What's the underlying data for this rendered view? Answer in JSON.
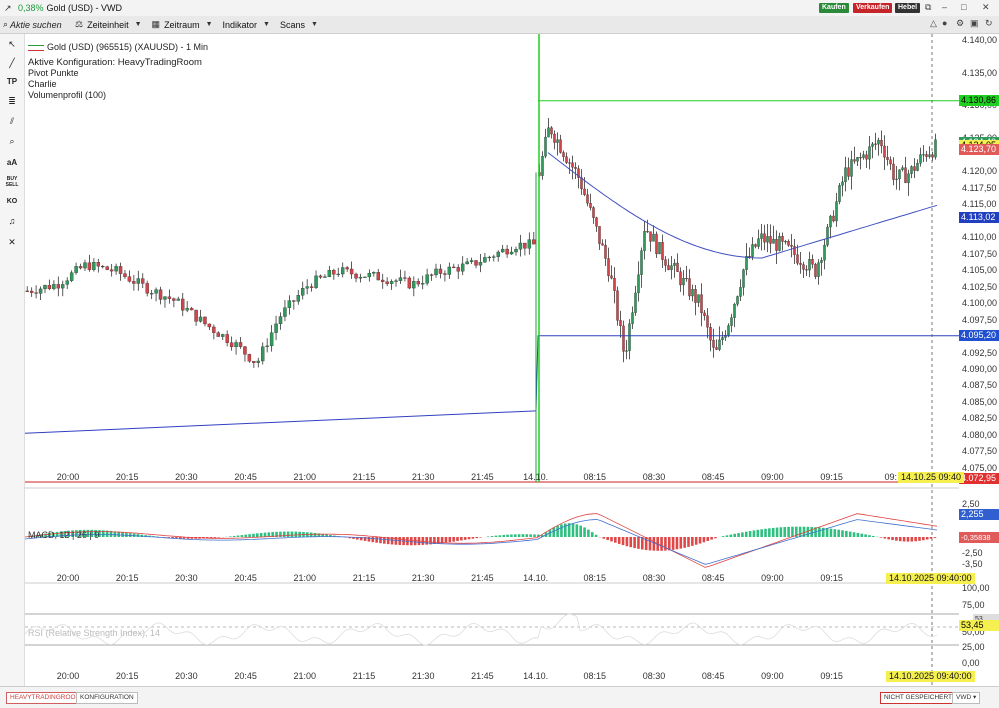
{
  "window": {
    "change_pct": "0,38%",
    "title": "Gold (USD) - VWD",
    "buttons": {
      "buy": "Kaufen",
      "sell": "Verkaufen",
      "leverage": "Hebel"
    },
    "colors": {
      "buy": "#2a8a3a",
      "sell": "#c4242a",
      "leverage": "#333333"
    }
  },
  "toolbar": {
    "search_placeholder": "Aktie suchen",
    "items": [
      {
        "label": "Zeiteinheit",
        "icon": "scale-icon"
      },
      {
        "label": "Zeitraum",
        "icon": "calendar-icon"
      },
      {
        "label": "Indikator",
        "icon": "none"
      },
      {
        "label": "Scans",
        "icon": "none"
      }
    ]
  },
  "left_tools": [
    "cursor-icon",
    "line-icon",
    "TP",
    "fib-icon",
    "parallel-icon",
    "zoom-icon",
    "aA",
    "BUY SELL",
    "KO",
    "sound-icon",
    "close-icon"
  ],
  "legend": {
    "instrument": "Gold (USD) (965515) (XAUUSD) - 1 Min",
    "config": "Aktive Konfiguration: HeavyTradingRoom",
    "pivot": "Pivot Punkte",
    "charlie": "Charlie",
    "volume": "Volumenprofil (100)"
  },
  "price_axis": {
    "labels": [
      "4.140,00",
      "4.135,00",
      "4.130,00",
      "4.125,00",
      "4.120,00",
      "4.117,50",
      "4.115,00",
      "4.110,00",
      "4.107,50",
      "4.105,00",
      "4.102,50",
      "4.100,00",
      "4.097,50",
      "4.092,50",
      "4.090,00",
      "4.087,50",
      "4.085,00",
      "4.082,50",
      "4.080,00",
      "4.077,50",
      "4.075,00"
    ],
    "tags": [
      {
        "value": "4.130,86",
        "bg": "#20d020",
        "fg": "#000000"
      },
      {
        "value": "4.124,40",
        "bg": "#2f9a5c",
        "fg": "#ffffff"
      },
      {
        "value": "4.124,05",
        "bg": "#f5f050",
        "fg": "#000000"
      },
      {
        "value": "4.123,70",
        "bg": "#e05a5a",
        "fg": "#ffffff"
      },
      {
        "value": "4.113,02",
        "bg": "#2040c0",
        "fg": "#ffffff"
      },
      {
        "value": "4.095,20",
        "bg": "#2050d0",
        "fg": "#ffffff"
      },
      {
        "value": "4.072,95",
        "bg": "#e03030",
        "fg": "#ffffff"
      }
    ]
  },
  "time_axis": [
    "20:00",
    "20:15",
    "20:30",
    "20:45",
    "21:00",
    "21:15",
    "21:30",
    "21:45",
    "14.10.",
    "08:15",
    "08:30",
    "08:45",
    "09:00",
    "09:15",
    "09:"
  ],
  "crosshair_date_main": "14.10.25 09:40",
  "macd": {
    "label": "MACD, 12 | 26 | 9",
    "axis": [
      "2,50",
      "0,00",
      "-2,50",
      "-3,50"
    ],
    "tags": [
      {
        "value": "2,255",
        "bg": "#3060d0",
        "fg": "#ffffff"
      },
      {
        "value": "-0,35838",
        "bg": "#e05a5a",
        "fg": "#ffffff"
      }
    ],
    "time_axis": [
      "20:00",
      "20:15",
      "20:30",
      "20:45",
      "21:00",
      "21:15",
      "21:30",
      "21:45",
      "14.10.",
      "08:15",
      "08:30",
      "08:45",
      "09:00",
      "09:15"
    ],
    "date_tag": "14.10.2025 09:40:00"
  },
  "rsi": {
    "label": "RSI (Relative Strength Index), 14",
    "axis": [
      "100,00",
      "75,00",
      "50,00",
      "25,00",
      "0,00"
    ],
    "tags": [
      {
        "value": "53,45",
        "bg": "#f5f050",
        "fg": "#000000"
      },
      {
        "value": "53",
        "bg": "#dddddd",
        "fg": "#333333"
      }
    ],
    "time_axis": [
      "20:00",
      "20:15",
      "20:30",
      "20:45",
      "21:00",
      "21:15",
      "21:30",
      "21:45",
      "14.10.",
      "08:15",
      "08:30",
      "08:45",
      "09:00",
      "09:15"
    ],
    "date_tag": "14.10.2025 09:40:00"
  },
  "status": {
    "tab1": "HEAVYTRADINGROOM",
    "tab2": "KONFIGURATION",
    "unsaved": "NICHT GESPEICHERT",
    "source": "VWD"
  }
}
